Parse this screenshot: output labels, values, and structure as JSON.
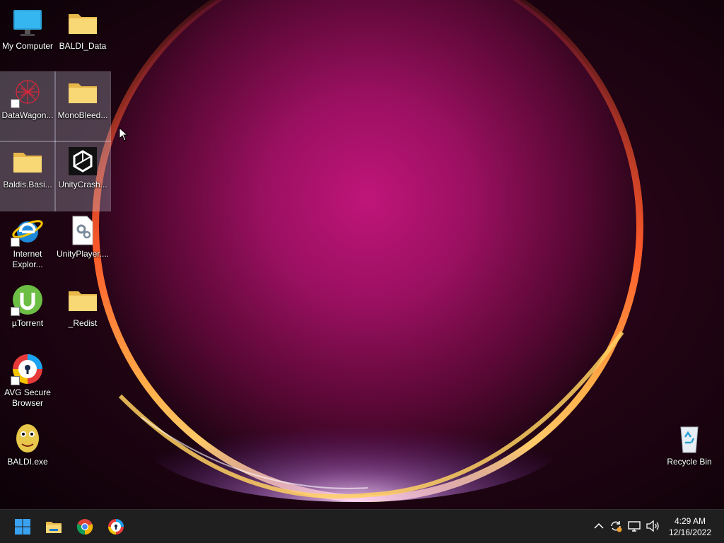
{
  "desktop": {
    "icons": [
      {
        "label": "My Computer"
      },
      {
        "label": "BALDI_Data"
      },
      {
        "label": "DataWagon..."
      },
      {
        "label": "MonoBleed..."
      },
      {
        "label": "Baldis.Basi..."
      },
      {
        "label": "UnityCrash..."
      },
      {
        "label": "Internet Explor..."
      },
      {
        "label": "UnityPlayer...."
      },
      {
        "label": "µTorrent"
      },
      {
        "label": "_Redist"
      },
      {
        "label": "AVG Secure Browser"
      },
      {
        "label": "BALDI.exe"
      },
      {
        "label": "Recycle Bin"
      }
    ]
  },
  "taskbar": {
    "pinned": [
      "windows-start-icon",
      "file-explorer-icon",
      "chrome-icon",
      "avg-secure-browser-icon"
    ],
    "tray": [
      "chevron-up-icon",
      "sync-icon",
      "network-icon",
      "volume-icon"
    ],
    "clock": {
      "time": "4:29 AM",
      "date": "12/16/2022"
    }
  },
  "colors": {
    "taskbar_bg": "#1f1f1f",
    "folder_yellow": "#f8d775",
    "accent_blue": "#1aa3f0"
  }
}
